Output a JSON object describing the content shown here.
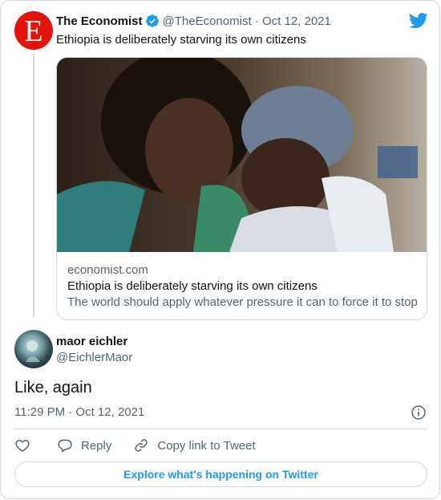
{
  "quoted_tweet": {
    "avatar_letter": "E",
    "author_name": "The Economist",
    "author_handle": "@TheEconomist",
    "date_sep": " · ",
    "date": "Oct 12, 2021",
    "text": "Ethiopia is deliberately starving its own citizens",
    "link_card": {
      "domain": "economist.com",
      "title": "Ethiopia is deliberately starving its own citizens",
      "description": "The world should apply whatever pressure it can to force it to stop"
    }
  },
  "tweet": {
    "author_name": "maor eichler",
    "author_handle": "@EichlerMaor",
    "text": "Like, again",
    "timestamp": "11:29 PM · Oct 12, 2021"
  },
  "actions": {
    "reply_label": "Reply",
    "copy_link_label": "Copy link to Tweet"
  },
  "explore_label": "Explore what's happening on Twitter",
  "colors": {
    "twitter_blue": "#1d9bf0",
    "economist_red": "#e3120b",
    "secondary_text": "#536471",
    "border": "#cfd9de"
  },
  "icons": [
    "twitter-logo-icon",
    "verified-badge-icon",
    "info-icon",
    "heart-icon",
    "reply-icon",
    "link-icon"
  ]
}
